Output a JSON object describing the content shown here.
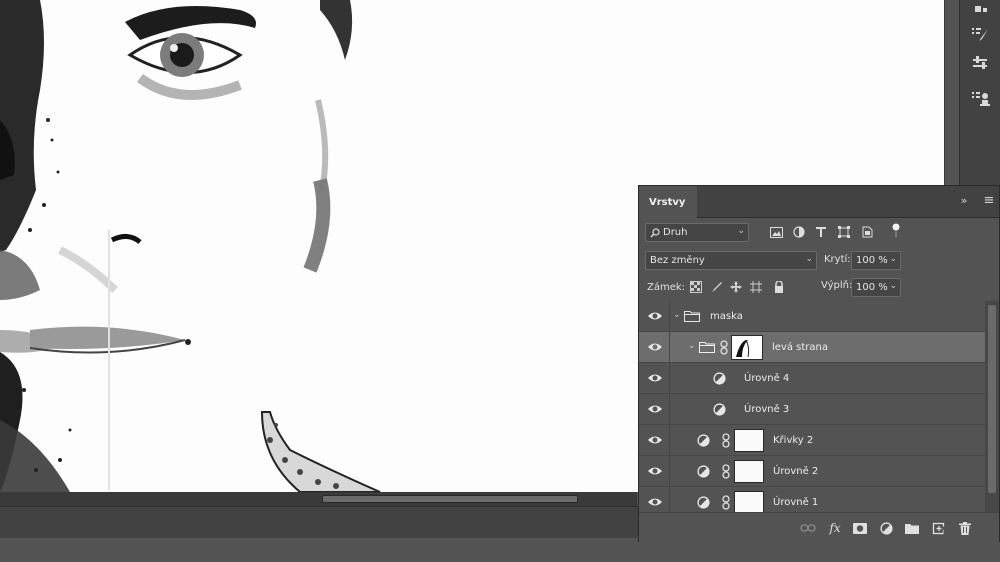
{
  "panel": {
    "tab_label": "Vrstvy",
    "collapse_glyph": "»",
    "menu_glyph": "≡"
  },
  "filter": {
    "kind_label": "Druh",
    "icons": [
      "image-filter-icon",
      "adjustment-filter-icon",
      "type-filter-icon",
      "shape-filter-icon",
      "smart-object-filter-icon"
    ]
  },
  "blend": {
    "mode": "Bez změny",
    "opacity_label": "Krytí:",
    "opacity_value": "100 %"
  },
  "lock": {
    "label": "Zámek:",
    "fill_label": "Výplň:",
    "fill_value": "100 %"
  },
  "layers": [
    {
      "name": "maska",
      "type": "group",
      "expanded": true,
      "indent": 0,
      "visible": true,
      "selected": false
    },
    {
      "name": "levá strana",
      "type": "group",
      "expanded": true,
      "indent": 1,
      "visible": true,
      "selected": true,
      "has_mask": true
    },
    {
      "name": "Úrovně 4",
      "type": "adjustment",
      "indent": 2,
      "visible": true,
      "selected": false
    },
    {
      "name": "Úrovně 3",
      "type": "adjustment",
      "indent": 2,
      "visible": true,
      "selected": false
    },
    {
      "name": "Křivky 2",
      "type": "adjustment",
      "indent": 1,
      "visible": true,
      "selected": false,
      "has_mask": true
    },
    {
      "name": "Úrovně 2",
      "type": "adjustment",
      "indent": 1,
      "visible": true,
      "selected": false,
      "has_mask": true
    },
    {
      "name": "Úrovně 1",
      "type": "adjustment",
      "indent": 1,
      "visible": true,
      "selected": false,
      "has_mask": true
    }
  ],
  "footer": {
    "buttons": [
      "link-layers-icon",
      "fx-icon",
      "add-mask-icon",
      "new-adjustment-icon",
      "new-group-icon",
      "new-layer-icon",
      "delete-layer-icon"
    ],
    "fx_label": "fx"
  },
  "colors": {
    "panel_bg": "#535353",
    "selected_row": "#6d6d6d",
    "canvas_bg": "#fdfdfd"
  }
}
